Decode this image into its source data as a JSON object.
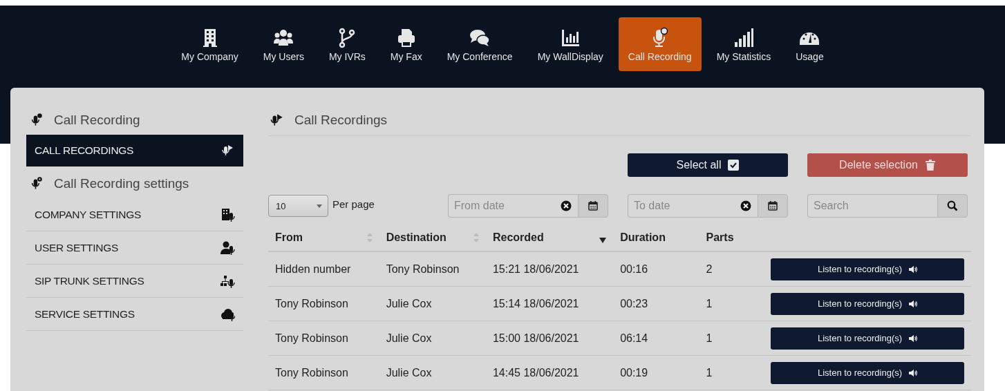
{
  "nav": [
    {
      "label": "My Company",
      "selected": false
    },
    {
      "label": "My Users",
      "selected": false
    },
    {
      "label": "My IVRs",
      "selected": false
    },
    {
      "label": "My Fax",
      "selected": false
    },
    {
      "label": "My Conference",
      "selected": false
    },
    {
      "label": "My WallDisplay",
      "selected": false
    },
    {
      "label": "Call Recording",
      "selected": true
    },
    {
      "label": "My Statistics",
      "selected": false
    },
    {
      "label": "Usage",
      "selected": false
    }
  ],
  "sidebar": {
    "sections": [
      {
        "title": "Call Recording",
        "items": [
          {
            "label": "CALL RECORDINGS",
            "selected": true
          }
        ]
      },
      {
        "title": "Call Recording settings",
        "items": [
          {
            "label": "COMPANY SETTINGS",
            "selected": false
          },
          {
            "label": "USER SETTINGS",
            "selected": false
          },
          {
            "label": "SIP TRUNK SETTINGS",
            "selected": false
          },
          {
            "label": "SERVICE SETTINGS",
            "selected": false
          }
        ]
      }
    ]
  },
  "main": {
    "title": "Call Recordings",
    "buttons": [
      {
        "label": "Select all",
        "kind": "select"
      },
      {
        "label": "Delete selection",
        "kind": "delete"
      }
    ],
    "per_page": {
      "value": "10",
      "label": "Per page"
    },
    "from_date": {
      "placeholder": "From date"
    },
    "to_date": {
      "placeholder": "To date"
    },
    "search": {
      "placeholder": "Search"
    },
    "table": {
      "columns": [
        {
          "label": "From",
          "sortable": true
        },
        {
          "label": "Destination",
          "sortable": true
        },
        {
          "label": "Recorded",
          "sorted_descending": true
        },
        {
          "label": "Duration"
        },
        {
          "label": "Parts"
        }
      ],
      "rows": [
        {
          "from": "Hidden number",
          "destination": "Tony Robinson",
          "recorded": "15:21 18/06/2021",
          "duration": "00:16",
          "parts": "2",
          "action": "Listen to recording(s)"
        },
        {
          "from": "Tony Robinson",
          "destination": "Julie Cox",
          "recorded": "15:14 18/06/2021",
          "duration": "00:23",
          "parts": "1",
          "action": "Listen to recording(s)"
        },
        {
          "from": "Tony Robinson",
          "destination": "Julie Cox",
          "recorded": "15:00 18/06/2021",
          "duration": "06:14",
          "parts": "1",
          "action": "Listen to recording(s)"
        },
        {
          "from": "Tony Robinson",
          "destination": "Julie Cox",
          "recorded": "14:45 18/06/2021",
          "duration": "00:19",
          "parts": "1",
          "action": "Listen to recording(s)"
        }
      ]
    }
  }
}
